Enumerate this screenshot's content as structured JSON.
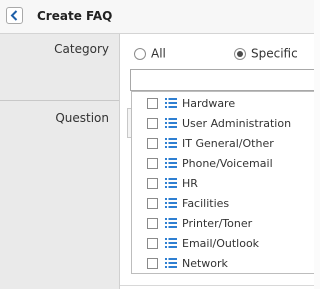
{
  "header": {
    "title": "Create FAQ",
    "back_icon": "chevron-left-icon"
  },
  "form": {
    "category_label": "Category",
    "question_label": "Question"
  },
  "category": {
    "options": [
      {
        "label": "All",
        "selected": false
      },
      {
        "label": "Specific",
        "selected": true
      }
    ],
    "search": {
      "value": "",
      "placeholder": ""
    }
  },
  "dropdown": {
    "item_icon": "list-icon",
    "item_icon_color": "#2f7fd1",
    "items": [
      {
        "label": "Hardware",
        "checked": false
      },
      {
        "label": "User Administration",
        "checked": false
      },
      {
        "label": "IT General/Other",
        "checked": false
      },
      {
        "label": "Phone/Voicemail",
        "checked": false
      },
      {
        "label": "HR",
        "checked": false
      },
      {
        "label": "Facilities",
        "checked": false
      },
      {
        "label": "Printer/Toner",
        "checked": false
      },
      {
        "label": "Email/Outlook",
        "checked": false
      },
      {
        "label": "Network",
        "checked": false
      }
    ]
  }
}
